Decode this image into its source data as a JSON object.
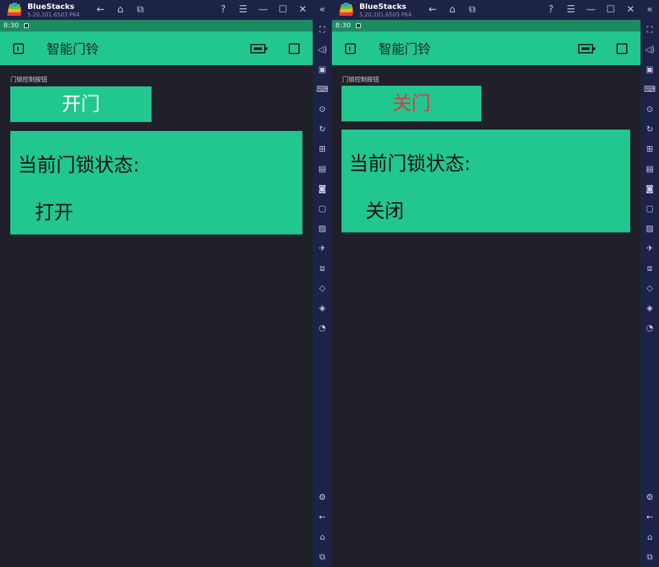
{
  "windows": [
    {
      "title_name": "BlueStacks",
      "title_version": "5.20.101.6503 P64",
      "status_time": "8:30",
      "app_title": "智能门铃",
      "section_label": "门锁控制按钮",
      "button_label": "开门",
      "status_label": "当前门锁状态:",
      "status_value": "打开"
    },
    {
      "title_name": "BlueStacks",
      "title_version": "5.20.101.6503 P64",
      "status_time": "8:30",
      "app_title": "智能门铃",
      "section_label": "门锁控制按钮",
      "button_label": "关门",
      "status_label": "当前门锁状态:",
      "status_value": "关闭"
    }
  ],
  "colors": {
    "app_bar": "#22c68f",
    "status_bar": "#1c8a63",
    "chrome": "#1d2347",
    "background": "#1f2029",
    "close_text": "#d9394b"
  },
  "icons": {
    "titlebar_nav": [
      "back-icon",
      "home-icon",
      "recents-icon"
    ],
    "titlebar_right": [
      "help-icon",
      "menu-icon",
      "minimize-icon",
      "maximize-icon",
      "close-icon"
    ],
    "sidebar_top": [
      "fullscreen-icon",
      "volume-icon",
      "pointer-icon",
      "keyboard-icon",
      "macro-icon",
      "sync-icon",
      "gamepad-icon",
      "apk-icon",
      "screenshot-icon",
      "record-icon",
      "media-icon",
      "airplane-icon",
      "multi-instance-icon",
      "eco-icon",
      "layers-icon",
      "performance-icon"
    ],
    "sidebar_bottom": [
      "settings-icon",
      "android-back-icon",
      "android-home-icon",
      "android-recents-icon"
    ]
  }
}
